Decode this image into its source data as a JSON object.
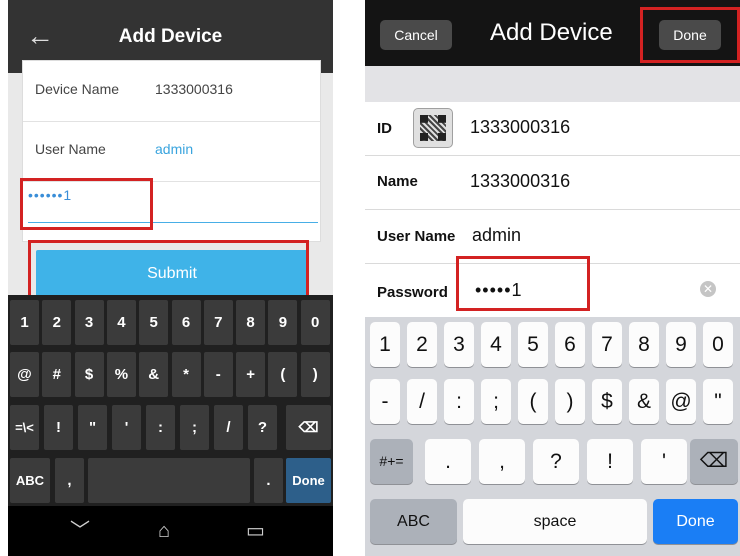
{
  "left": {
    "header": {
      "back_icon": "back-arrow-icon",
      "title": "Add Device"
    },
    "form": {
      "device_name_label": "Device Name",
      "device_name_value": "1333000316",
      "user_name_label": "User Name",
      "user_name_value": "admin",
      "password_value": "••••••1"
    },
    "submit_label": "Submit",
    "keyboard": {
      "row1": [
        "1",
        "2",
        "3",
        "4",
        "5",
        "6",
        "7",
        "8",
        "9",
        "0"
      ],
      "row2": [
        "@",
        "#",
        "$",
        "%",
        "&",
        "*",
        "-",
        "+",
        "(",
        ")"
      ],
      "row3": [
        "=\\<",
        "!",
        "\"",
        "'",
        ":",
        ";",
        "/",
        "?"
      ],
      "backspace_icon": "backspace-icon",
      "abc_label": "ABC",
      "comma": ",",
      "period": ".",
      "done_label": "Done"
    },
    "nav": {
      "back_icon": "nav-back-icon",
      "home_icon": "nav-home-icon",
      "recents_icon": "nav-recents-icon"
    }
  },
  "right": {
    "header": {
      "cancel_label": "Cancel",
      "title": "Add Device",
      "done_label": "Done"
    },
    "form": {
      "id_label": "ID",
      "id_value": "1333000316",
      "qr_icon": "qr-code-icon",
      "name_label": "Name",
      "name_value": "1333000316",
      "user_name_label": "User Name",
      "user_name_value": "admin",
      "password_label": "Password",
      "password_value": "•••••1",
      "clear_icon": "clear-icon"
    },
    "keyboard": {
      "row1": [
        "1",
        "2",
        "3",
        "4",
        "5",
        "6",
        "7",
        "8",
        "9",
        "0"
      ],
      "row2": [
        "-",
        "/",
        ":",
        ";",
        "(",
        ")",
        "$",
        "&",
        "@",
        "\""
      ],
      "more_symbols": "#+=",
      "row3": [
        ".",
        ",",
        "?",
        "!",
        "'"
      ],
      "backspace_icon": "backspace-icon",
      "abc_label": "ABC",
      "space_label": "space",
      "done_label": "Done"
    }
  },
  "colors": {
    "highlight": "#d32222",
    "submit": "#3fb3e8",
    "ios_done": "#1a7ef5"
  }
}
